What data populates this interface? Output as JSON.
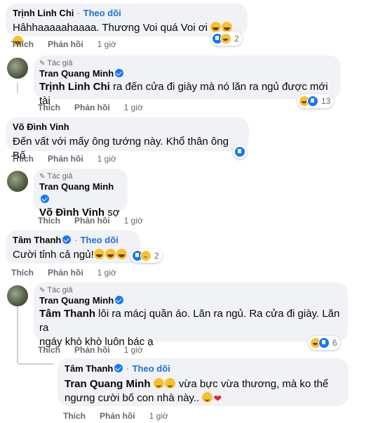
{
  "comments": [
    {
      "author": "Trịnh Linh Chi",
      "follow": "Theo dõi",
      "text": "Hâhhaaaaahaaaa. Thương Voi quá Voi ơi",
      "reaction_count": "2",
      "actions": {
        "like": "Thích",
        "reply": "Phản hồi",
        "time": "1 giờ"
      }
    },
    {
      "author_tag": "Tác giả",
      "author": "Tran Quang Minh",
      "mention": "Trịnh Linh Chi",
      "text": " ra đến cửa đi giày mà nó lăn ra ngủ được mới tài",
      "reaction_count": "13",
      "actions": {
        "like": "Thích",
        "reply": "Phản hồi",
        "time": "1 giờ"
      }
    },
    {
      "author": "Võ Đình Vinh",
      "text": "Đến vất với mấy ông tướng này. Khổ thân ông Bố",
      "actions": {
        "like": "Thích",
        "reply": "Phản hồi",
        "time": "1 giờ"
      }
    },
    {
      "author_tag": "Tác giả",
      "author": "Tran Quang Minh",
      "mention": "Võ Đình Vinh",
      "text": " sợ",
      "actions": {
        "like": "Thích",
        "reply": "Phản hồi",
        "time": "1 giờ"
      }
    },
    {
      "author": "Tâm Thanh",
      "follow": "Theo dõi",
      "text": "Cười tỉnh cả ngủ!",
      "reaction_count": "2",
      "actions": {
        "like": "Thích",
        "reply": "Phản hồi",
        "time": "1 giờ"
      }
    },
    {
      "author_tag": "Tác giả",
      "author": "Tran Quang Minh",
      "mention": "Tâm Thanh",
      "text_line1": " lôi ra mácj quần áo. Lăn ra ngủ. Ra cửa đi giày. Lăn ra",
      "text_line2": "ngáy khò khò luôn bác ạ",
      "reaction_count": "6",
      "actions": {
        "like": "Thích",
        "reply": "Phản hồi",
        "time": "1 giờ"
      }
    },
    {
      "author": "Tâm Thanh",
      "follow": "Theo dõi",
      "mention": "Tran Quang Minh",
      "text_line1": "vừa bực vừa thương, mà ko thể",
      "text_line2": "ngưng cười bố con nhà này..",
      "actions": {
        "like": "Thích",
        "reply": "Phản hồi",
        "time": "1 giờ"
      }
    }
  ],
  "colors": {
    "bubble": "#f0f2f5",
    "link": "#216fdb",
    "verified": "#1877f2",
    "muted": "#65676b"
  }
}
